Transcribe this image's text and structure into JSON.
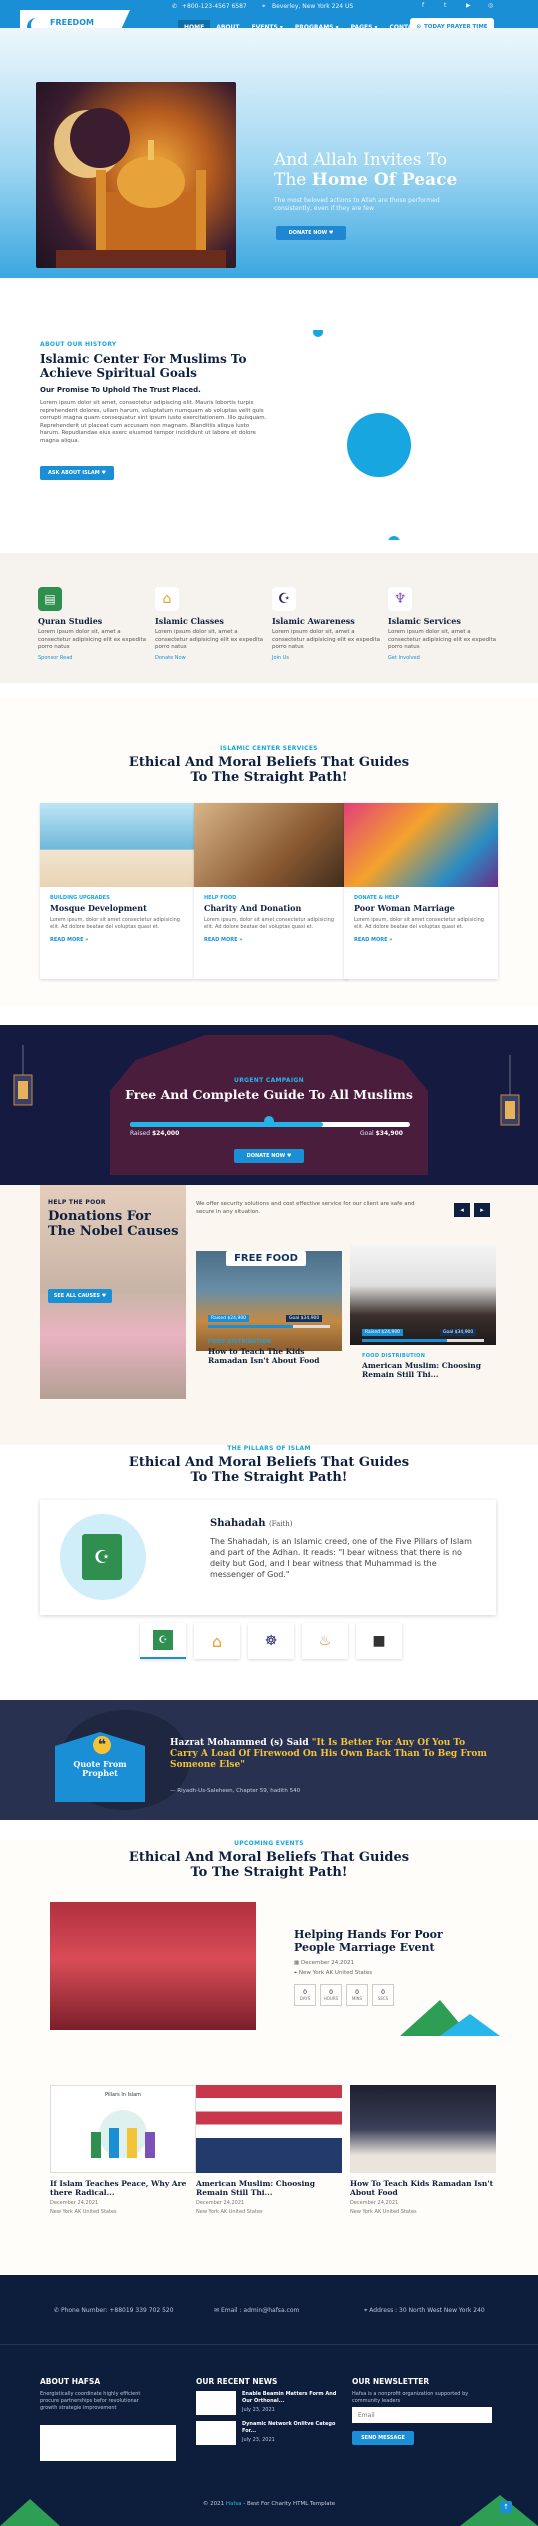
{
  "brand": {
    "name": "FREEDOM",
    "tagline": "ISLAMIC CENTER"
  },
  "topbar": {
    "phone": "+800-123-4567 6587",
    "location": "Beverley, New York 224 US"
  },
  "nav": {
    "items": [
      "HOME",
      "ABOUT",
      "EVENTS ▾",
      "PROGRAMS ▾",
      "PAGES ▾",
      "CONTACT"
    ],
    "donate_label": "TODAY PRAYER TIME"
  },
  "hero": {
    "title_line1": "And Allah Invites To",
    "title_line2_prefix": "The",
    "title_line2_strong": "Home Of Peace",
    "subtitle": "The most beloved actions to Allah are those performed consistently, even if they are few",
    "button": "DONATE NOW ♥"
  },
  "about": {
    "tag": "ABOUT OUR HISTORY",
    "title": "Islamic Center For Muslims To Achieve Spiritual Goals",
    "subtitle": "Our Promise To Uphold The Trust Placed.",
    "body": "Lorem ipsum dolor sit amet, consectetur adipiscing elit. Mauris lobortis turpis reprehenderit dolores, ullam harum, voluptatum numquam ab voluptas velit quis corrupti magna quam consequatur sint ipsum iusto exercitationem. Illo quisquam. Reprehenderit ut placeat cum accusam non magnam. Blanditiis aliqua iusto harum. Repudiandae eius exerc eiusmod tempor incididunt ut labore et dolore magna aliqua.",
    "button": "ASK ABOUT ISLAM ♥"
  },
  "services": [
    {
      "title": "Quran Studies",
      "text": "Lorem ipsum dolor sit, amet a consectetur adipisicing elit ex expedita porro natus",
      "link": "Sponsor Read",
      "color": "#2f8f4e"
    },
    {
      "title": "Islamic Classes",
      "text": "Lorem ipsum dolor sit, amet a consectetur adipisicing elit ex expedita porro natus",
      "link": "Donate Now",
      "color": "#e9a02a"
    },
    {
      "title": "Islamic Awareness",
      "text": "Lorem ipsum dolor sit, amet a consectetur adipisicing elit ex expedita porro natus",
      "link": "Join Us",
      "color": "#2a2a6a"
    },
    {
      "title": "Islamic Services",
      "text": "Lorem ipsum dolor sit, amet a consectetur adipisicing elit ex expedita porro natus",
      "link": "Get Involved",
      "color": "#7a52b8"
    }
  ],
  "center": {
    "tag": "ISLAMIC CENTER SERVICES",
    "title_l1": "Ethical And Moral Beliefs That Guides",
    "title_l2": "To The Straight Path!",
    "cards": [
      {
        "tag": "BUILDING UPGRADES",
        "title": "Mosque Development",
        "text": "Lorem ipsum, dolor sit amet consectetur adipisicing elit. Ad dolore beatae del voluptas quasi et.",
        "more": "READ MORE »"
      },
      {
        "tag": "HELP FOOD",
        "title": "Charity And Donation",
        "text": "Lorem ipsum, dolor sit amet consectetur adipisicing elit. Ad dolore beatae del voluptas quasi et.",
        "more": "READ MORE »"
      },
      {
        "tag": "DONATE & HELP",
        "title": "Poor Woman Marriage",
        "text": "Lorem ipsum, dolor sit amet consectetur adipisicing elit. Ad dolore beatae del voluptas quasi et.",
        "more": "READ MORE »"
      }
    ]
  },
  "campaign": {
    "tag": "URGENT CAMPAIGN",
    "title": "Free And Complete Guide To All Muslims",
    "raised_label": "Raised",
    "raised": "$24,000",
    "goal_label": "Goal",
    "goal": "$34,900",
    "progress": 0.69,
    "button": "DONATE NOW ♥"
  },
  "donations": {
    "tag": "HELP THE POOR",
    "title": "Donations For The Nobel Causes",
    "intro": "We offer security solutions and cost effective service for our client are safe and secure in any situation.",
    "button": "SEE ALL CAUSES ♥",
    "causes": [
      {
        "tag": "FOOD DISTRIBUTION",
        "title": "How to Teach The Kids Ramadan Isn't About Food",
        "raised": "Raised $24,900",
        "goal": "Goal $34,900",
        "img_text": "FREE FOOD"
      },
      {
        "tag": "FOOD DISTRIBUTION",
        "title": "American Muslim: Choosing Remain Still Thi...",
        "raised": "Raised $24,900",
        "goal": "Goal $34,900"
      }
    ]
  },
  "pillars": {
    "tag": "THE PILLARS OF ISLAM",
    "title_l1": "Ethical And Moral Beliefs That Guides",
    "title_l2": "To The Straight Path!",
    "active_title": "Shahadah",
    "active_sub": "(Faith)",
    "active_text": "The Shahadah, is an Islamic creed, one of the Five Pillars of Islam and part of the Adhan. It reads: \"I bear witness that there is no deity but God, and I bear witness that Muhammad is the messenger of God.\""
  },
  "quote": {
    "badge": "Quote From Prophet",
    "author": "Hazrat Mohammed (s) Said",
    "text": "\"It Is Better For Any Of You To Carry A Load Of Firewood On His Own Back Than To Beg From Someone Else\"",
    "source": "— Riyadh-Us-Saleheen, Chapter 59, hadith 540"
  },
  "events": {
    "tag": "UPCOMING EVENTS",
    "title_l1": "Ethical And Moral Beliefs That Guides",
    "title_l2": "To The Straight Path!",
    "featured": {
      "title": "Helping Hands For Poor People Marriage Event",
      "date": "December 24,2021",
      "location": "New York AK United States",
      "countdown": [
        {
          "v": "0",
          "u": "DAYS"
        },
        {
          "v": "0",
          "u": "HOURS"
        },
        {
          "v": "0",
          "u": "MINS"
        },
        {
          "v": "0",
          "u": "SECS"
        }
      ]
    },
    "cards": [
      {
        "img_text": "Pillars In Islam",
        "title": "If Islam Teaches Peace, Why Are there Radical...",
        "date": "December 24,2021",
        "location": "New York AK United States"
      },
      {
        "title": "American Muslim: Choosing Remain Still Thi...",
        "date": "December 24,2021",
        "location": "New York AK United States"
      },
      {
        "title": "How To Teach Kids Ramadan Isn't About Food",
        "date": "December 24,2021",
        "location": "New York AK United States"
      }
    ]
  },
  "footer": {
    "phone": "Phone Number: +88019 339 702 520",
    "email": "Email : admin@hafsa.com",
    "address": "Address : 30 North West New York 240",
    "about_head": "ABOUT HAFSA",
    "about_text": "Energistically coordinate highly efficient procure partnerships befor revolutionar growth strategie improvement",
    "news_head": "OUR RECENT NEWS",
    "news": [
      {
        "title": "Enable Beamin Matters Form And Our Orthonal...",
        "date": "July 23, 2021"
      },
      {
        "title": "Dynamic Network Onlitve Catego For...",
        "date": "July 23, 2021"
      }
    ],
    "newsletter_head": "OUR NEWSLETTER",
    "newsletter_text": "Hafsa is a nonprofit organization supported by community leaders",
    "email_placeholder": "Email",
    "send_button": "SEND MESSAGE",
    "copyright_prefix": "© 2021",
    "copyright_brand": "Hafsa",
    "copyright_suffix": " - Best For Charity HTML Template"
  }
}
